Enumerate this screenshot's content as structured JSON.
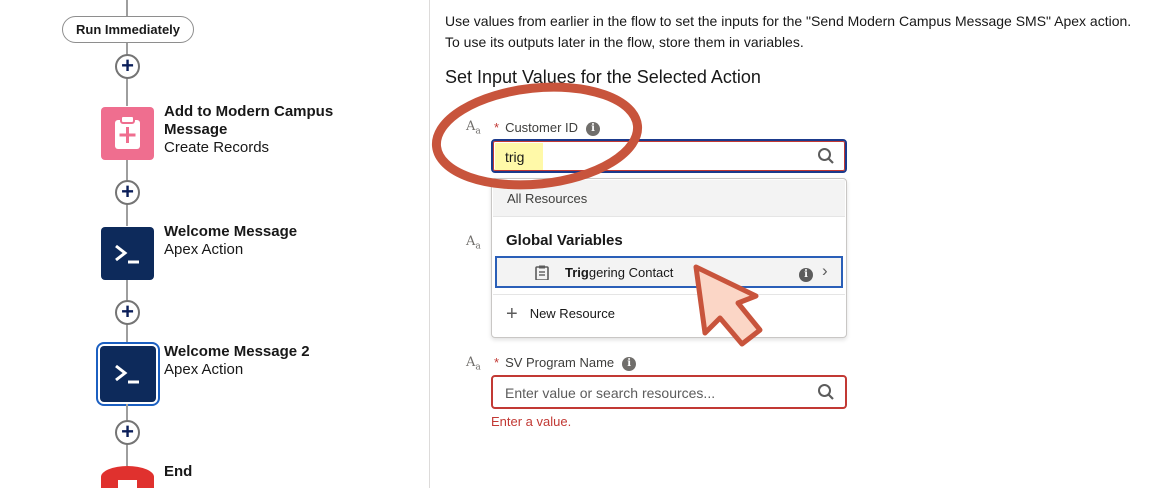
{
  "flow": {
    "start_pill": "Run Immediately",
    "nodes": [
      {
        "title": "Add to Modern Campus",
        "title2": "Message",
        "subtitle": "Create Records",
        "icon": "clipboard-plus-icon",
        "color": "#ef6e8f"
      },
      {
        "title": "Welcome Message",
        "subtitle": "Apex Action",
        "icon": "apex-action-icon",
        "color": "#0d2a5b"
      },
      {
        "title": "Welcome Message 2",
        "subtitle": "Apex Action",
        "icon": "apex-action-icon",
        "color": "#0d2a5b",
        "selected": true
      },
      {
        "title": "End",
        "icon": "stop-icon",
        "color": "#e0312e"
      }
    ],
    "add_symbol": "+"
  },
  "panel": {
    "description": "Use values from earlier in the flow to set the inputs for the \"Send Modern Campus Message SMS\" Apex action. To use its outputs later in the flow, store them in variables.",
    "section_title": "Set Input Values for the Selected Action",
    "type_icon": "Aa",
    "fields": [
      {
        "label": "Customer ID",
        "required_mark": "*",
        "value": "trig"
      },
      {
        "label": "SV Program Name",
        "required_mark": "*",
        "placeholder": "Enter value or search resources...",
        "error": "Enter a value."
      }
    ],
    "dropdown": {
      "header": "All Resources",
      "group": "Global Variables",
      "item_bold": "Trig",
      "item_rest": "gering Contact",
      "new_resource": "New Resource"
    },
    "info_glyph": "i",
    "chevron": "›"
  },
  "annotation": {
    "color": "#c8543c",
    "highlight": "#fff9a8"
  }
}
